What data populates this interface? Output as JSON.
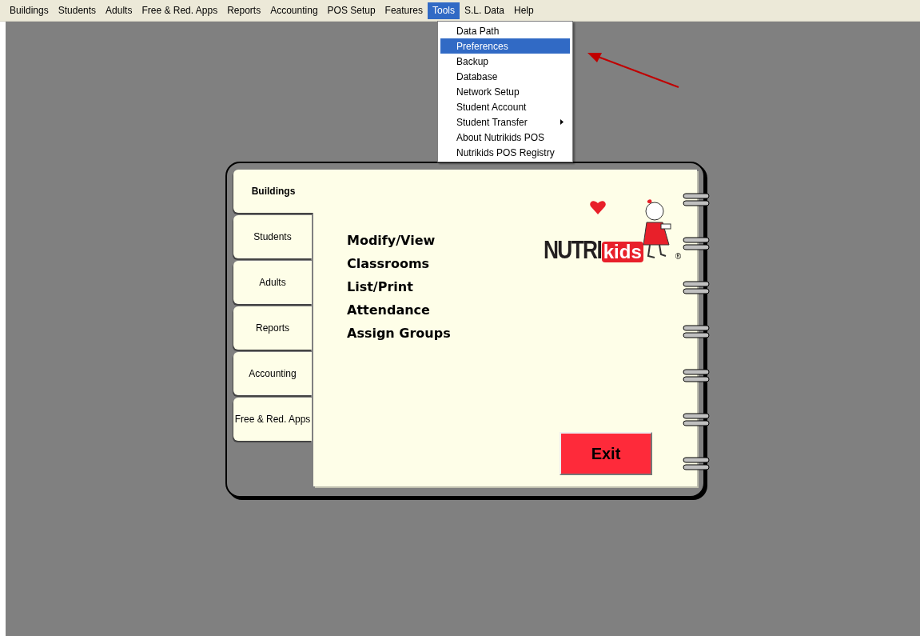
{
  "menu_bar": [
    {
      "label": "Buildings",
      "selected": false
    },
    {
      "label": "Students",
      "selected": false
    },
    {
      "label": "Adults",
      "selected": false
    },
    {
      "label": "Free & Red. Apps",
      "selected": false
    },
    {
      "label": "Reports",
      "selected": false
    },
    {
      "label": "Accounting",
      "selected": false
    },
    {
      "label": "POS Setup",
      "selected": false
    },
    {
      "label": "Features",
      "selected": false
    },
    {
      "label": "Tools",
      "selected": true
    },
    {
      "label": "S.L. Data",
      "selected": false
    },
    {
      "label": "Help",
      "selected": false
    }
  ],
  "dropdown": {
    "items": [
      {
        "label": "Data Path",
        "selected": false,
        "submenu": false
      },
      {
        "label": "Preferences",
        "selected": true,
        "submenu": false
      },
      {
        "label": "Backup",
        "selected": false,
        "submenu": false
      },
      {
        "label": "Database",
        "selected": false,
        "submenu": false
      },
      {
        "label": "Network Setup",
        "selected": false,
        "submenu": false
      },
      {
        "label": "Student Account",
        "selected": false,
        "submenu": false
      },
      {
        "label": "Student Transfer",
        "selected": false,
        "submenu": true
      },
      {
        "label": "About Nutrikids POS",
        "selected": false,
        "submenu": false
      },
      {
        "label": "Nutrikids POS Registry",
        "selected": false,
        "submenu": false
      }
    ]
  },
  "notebook": {
    "tabs": [
      {
        "label": "Buildings",
        "selected": true
      },
      {
        "label": "Students",
        "selected": false
      },
      {
        "label": "Adults",
        "selected": false
      },
      {
        "label": "Reports",
        "selected": false
      },
      {
        "label": "Accounting",
        "selected": false
      },
      {
        "label": "Free & Red. Apps",
        "selected": false
      }
    ],
    "links": [
      "Modify/View",
      "Classrooms",
      "List/Print",
      "Attendance",
      "Assign Groups"
    ],
    "logo": {
      "text_1": "NUTRI",
      "text_2": "kids",
      "mark": "®"
    },
    "exit_button": "Exit"
  }
}
